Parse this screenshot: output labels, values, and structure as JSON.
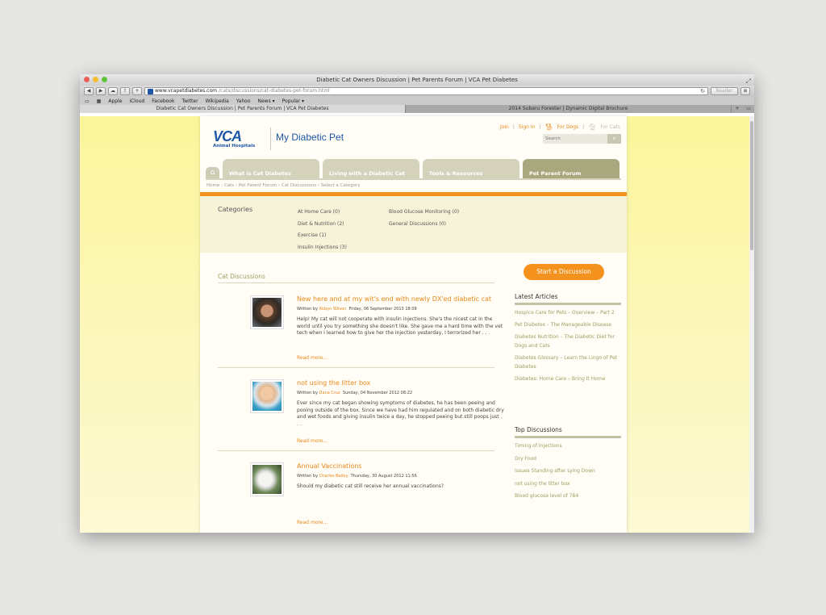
{
  "window": {
    "title": "Diabetic Cat Owners Discussion | Pet Parents Forum | VCA Pet Diabetes"
  },
  "toolbar": {
    "back": "◀",
    "forward": "▶",
    "address_host": "www.vcapetdiabetes.com",
    "address_path": "/cats/discussions/cat-diabetes-pet-forum.html",
    "reader": "Reader"
  },
  "bookmarks": [
    "Apple",
    "iCloud",
    "Facebook",
    "Twitter",
    "Wikipedia",
    "Yahoo",
    "News ▾",
    "Popular ▾"
  ],
  "tabs": [
    {
      "label": "Diabetic Cat Owners Discussion | Pet Parents Forum | VCA Pet Diabetes"
    },
    {
      "label": "2014 Subaru Forester | Dynamic Digital Brochure"
    }
  ],
  "header": {
    "join": "Join",
    "sign_in": "Sign In",
    "for_dogs": "For Dogs",
    "for_cats": "For Cats",
    "logo": "VCA",
    "logo_sub": "Animal Hospitals",
    "site_title": "My Diabetic Pet",
    "search_placeholder": "Search"
  },
  "nav": {
    "home_icon": "⌂",
    "items": [
      "What is Cat Diabetes",
      "Living with a Diabetic Cat",
      "Tools & Resources",
      "Pet Parent Forum"
    ]
  },
  "breadcrumb": "Home › Cats › Pet Parent Forum › Cat Discussions › Select a Category",
  "categories": {
    "label": "Categories",
    "col1": [
      "At Home Care  (0)",
      "Diet & Nutrition  (2)",
      "Exercise  (1)",
      "Insulin Injections  (3)"
    ],
    "col2": [
      "Blood Glucose Monitoring  (0)",
      "General Discussions  (0)"
    ]
  },
  "discussions": {
    "title": "Cat Discussions",
    "start_button": "Start a Discussion",
    "posts": [
      {
        "title": "New here and at my wit's end with newly DX'ed diabetic cat",
        "written_by": "Written by",
        "author": "Robyn Wilson",
        "date": "Friday, 06 September 2013 18:09",
        "text": "Help! My cat will not cooperate with insulin injections. She's the nicest cat in the world until you try something she doesn't like. She gave me a hard time with the vet tech when I learned how to give her the injection yesterday, I terrorized her . . .",
        "read_more": "Read more..."
      },
      {
        "title": "not using the litter box",
        "written_by": "Written by",
        "author": "Dana Cruz",
        "date": "Sunday, 04 November 2012 08:22",
        "text": "Ever since my cat began showing symptoms of diabetes, he has been peeing and pooing outside of the box.  Since we have had him regulated and on both diabetic dry and wet foods and giving insulin twice a day, he stopped peeing but still poops just . . .",
        "read_more": "Read more..."
      },
      {
        "title": "Annual Vaccinations",
        "written_by": "Written by",
        "author": "Charles Bailey",
        "date": "Thursday, 30 August 2012 11:56",
        "text": "Should my diabetic cat still receive her annual vaccinations?",
        "read_more": "Read more..."
      }
    ]
  },
  "sidebar": {
    "latest_title": "Latest Articles",
    "latest": [
      "Hospice Care for Pets – Overview – Part 2",
      "Pet Diabetes – The Manageable Disease",
      "Diabetes Nutrition – The Diabetic Diet for Dogs and Cats",
      "Diabetes Glossary – Learn the Lingo of Pet Diabetes",
      "Diabetes: Home Care – Bring It Home"
    ],
    "top_title": "Top Discussions",
    "top": [
      "Timing of Injections",
      "Dry Food",
      "Issues Standing after Lying Down",
      "not using the litter box",
      "Blood glucose level of 784"
    ]
  }
}
